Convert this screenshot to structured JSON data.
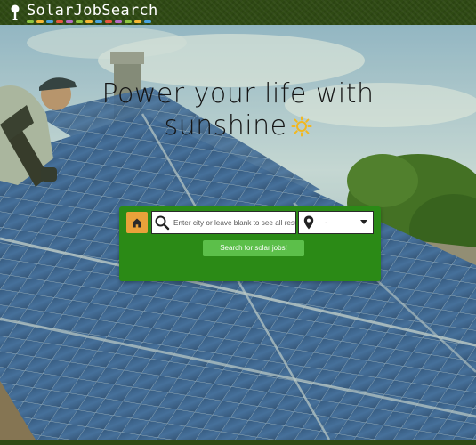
{
  "header": {
    "logo_text": "SolarJobSearch",
    "logo_dot_colors": [
      "#8ec63f",
      "#f7b733",
      "#4aa3df",
      "#e8573f",
      "#b66cc6",
      "#8ec63f",
      "#f7b733",
      "#4aa3df",
      "#e8573f",
      "#b66cc6",
      "#8ec63f",
      "#f7b733",
      "#4aa3df"
    ]
  },
  "hero": {
    "title_line1": "Power your life with",
    "title_line2": "sunshine",
    "title_icon": "sun-icon"
  },
  "search": {
    "home_icon": "home-icon",
    "city_placeholder": "Enter city or leave blank to see all results",
    "city_value": "",
    "location_value": "-",
    "submit_label": "Search for solar jobs!"
  },
  "colors": {
    "header_bg": "#2f4a14",
    "panel_bg": "#2b8a16",
    "home_button": "#e9a23a",
    "submit_button": "#5cbf4a"
  }
}
